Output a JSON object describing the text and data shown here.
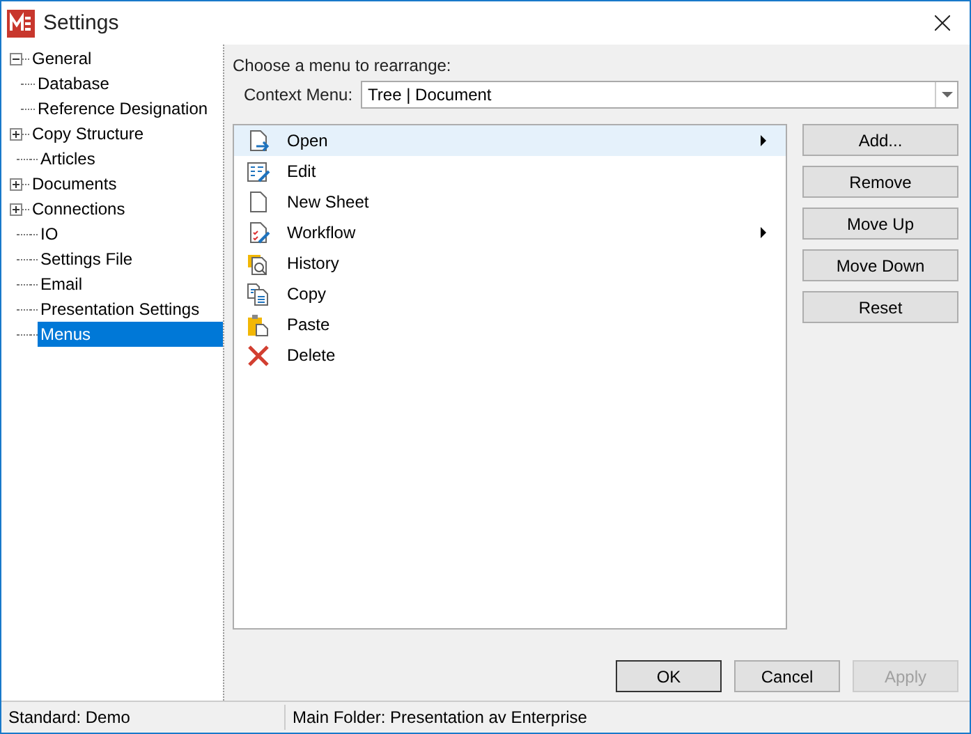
{
  "window": {
    "title": "Settings"
  },
  "tree": [
    {
      "kind": "folder",
      "label": "General",
      "expanded": true,
      "selected": false,
      "children": [
        {
          "label": "Database",
          "selected": false
        },
        {
          "label": "Reference Designation",
          "selected": false
        }
      ]
    },
    {
      "kind": "folder",
      "label": "Copy Structure",
      "expanded": false,
      "selected": false
    },
    {
      "kind": "leaf",
      "label": "Articles",
      "selected": false
    },
    {
      "kind": "folder",
      "label": "Documents",
      "expanded": false,
      "selected": false
    },
    {
      "kind": "folder",
      "label": "Connections",
      "expanded": false,
      "selected": false
    },
    {
      "kind": "leaf",
      "label": "IO",
      "selected": false
    },
    {
      "kind": "leaf",
      "label": "Settings File",
      "selected": false
    },
    {
      "kind": "leaf",
      "label": "Email",
      "selected": false
    },
    {
      "kind": "leaf",
      "label": "Presentation Settings",
      "selected": false
    },
    {
      "kind": "leaf",
      "label": "Menus",
      "selected": true
    }
  ],
  "prompt": "Choose a menu to rearrange:",
  "context_menu": {
    "label": "Context Menu:",
    "value": "Tree | Document"
  },
  "menu_items": [
    {
      "kind": "open",
      "label": "Open",
      "submenu": true,
      "selected": true
    },
    {
      "kind": "edit",
      "label": "Edit",
      "submenu": false,
      "selected": false
    },
    {
      "kind": "sheet",
      "label": "New Sheet",
      "submenu": false,
      "selected": false
    },
    {
      "kind": "workflow",
      "label": "Workflow",
      "submenu": true,
      "selected": false
    },
    {
      "kind": "history",
      "label": "History",
      "submenu": false,
      "selected": false
    },
    {
      "kind": "copy",
      "label": "Copy",
      "submenu": false,
      "selected": false
    },
    {
      "kind": "paste",
      "label": "Paste",
      "submenu": false,
      "selected": false
    },
    {
      "kind": "delete",
      "label": "Delete",
      "submenu": false,
      "selected": false
    }
  ],
  "side_buttons": [
    {
      "label": "Add..."
    },
    {
      "label": "Remove"
    },
    {
      "label": "Move Up"
    },
    {
      "label": "Move Down"
    },
    {
      "label": "Reset"
    }
  ],
  "dialog_buttons": [
    {
      "label": "OK",
      "default": true,
      "disabled": false
    },
    {
      "label": "Cancel",
      "default": false,
      "disabled": false
    },
    {
      "label": "Apply",
      "default": false,
      "disabled": true
    }
  ],
  "status_bar": [
    "Standard: Demo",
    "Main Folder: Presentation av Enterprise"
  ]
}
